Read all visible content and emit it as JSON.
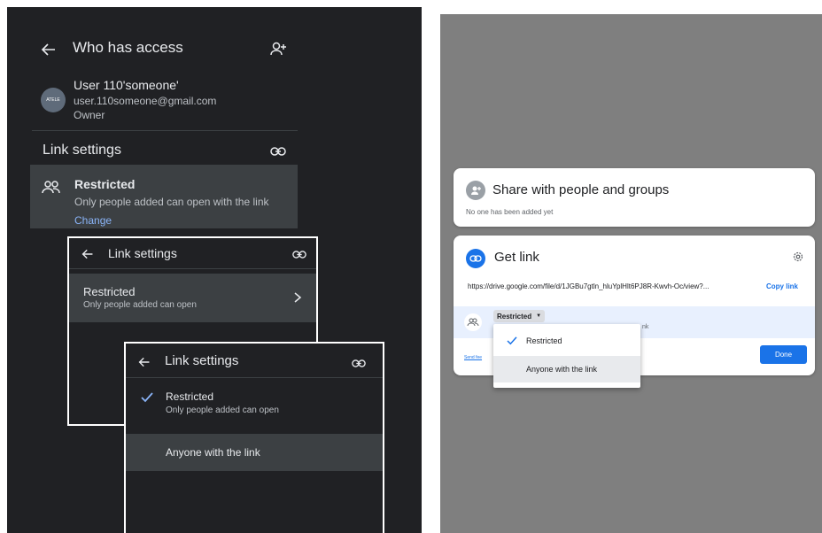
{
  "left": {
    "header": {
      "title": "Who has access"
    },
    "user": {
      "name": "User 110'someone'",
      "email": "user.110someone@gmail.com",
      "role": "Owner",
      "avatar_text": "ATELE"
    },
    "link_settings": {
      "title": "Link settings",
      "restricted_title": "Restricted",
      "restricted_desc": "Only people added can open with the link",
      "change_label": "Change"
    },
    "popup1": {
      "title": "Link settings",
      "option_title": "Restricted",
      "option_desc": "Only people added can open"
    },
    "popup2": {
      "title": "Link settings",
      "option1_title": "Restricted",
      "option1_desc": "Only people added can open",
      "option2_title": "Anyone with the link"
    }
  },
  "right": {
    "share": {
      "title": "Share with people and groups",
      "subtitle": "No one has been added yet"
    },
    "get_link": {
      "title": "Get link",
      "url": "https://drive.google.com/file/d/1JGBu7gtln_hluYplHlt6PJ8R-Kwvh-Oc/view?...",
      "copy_label": "Copy link",
      "access_value": "Restricted",
      "hidden_desc_tail": "nk",
      "send_feedback": "Send fee",
      "done_label": "Done"
    },
    "dropdown": {
      "options": [
        "Restricted",
        "Anyone with the link"
      ]
    }
  },
  "colors": {
    "dark_bg": "#202124",
    "accent_blue": "#1a73e8",
    "light_blue": "#8ab4f8",
    "gray_bg": "#7f7f7f"
  }
}
